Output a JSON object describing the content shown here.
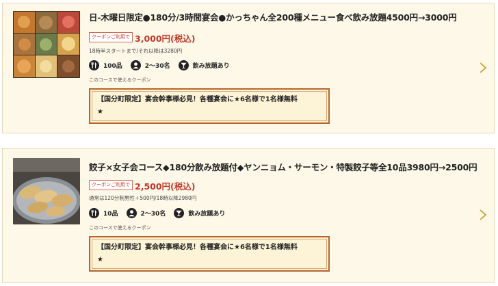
{
  "courses": [
    {
      "title": "日-木曜日限定●180分/3時間宴会●かっちゃん全200種メニュー食べ飲み放題4500円→3000円",
      "coupon_badge": "クーポンご利用で",
      "price": "3,000円(税込)",
      "note": "18時半スタートまで/それ以降は3280円",
      "items": "100品",
      "people": "2～30名",
      "drink": "飲み放題あり",
      "coupon_caption": "このコースで使えるクーポン",
      "coupon_line1": "【国分町限定】宴会幹事様必見！各種宴会に★6名様で1名様無料",
      "coupon_line2": "★"
    },
    {
      "title": "餃子×女子会コース◆180分飲み放題付◆ヤンニョム・サーモン・特製餃子等全10品3980円→2500円",
      "coupon_badge": "クーポンご利用で",
      "price": "2,500円(税込)",
      "note": "通常は120分制男性＋500円/18時以降2980円",
      "items": "10品",
      "people": "2～30名",
      "drink": "飲み放題あり",
      "coupon_caption": "このコースで使えるクーポン",
      "coupon_line1": "【国分町限定】宴会幹事様必見！各種宴会に★6名様で1名様無料",
      "coupon_line2": "★"
    }
  ],
  "colors": {
    "card_bg": "#fdf8e8",
    "price": "#c0392b",
    "coupon_border": "#b5652a",
    "chevron": "#c9a032"
  }
}
